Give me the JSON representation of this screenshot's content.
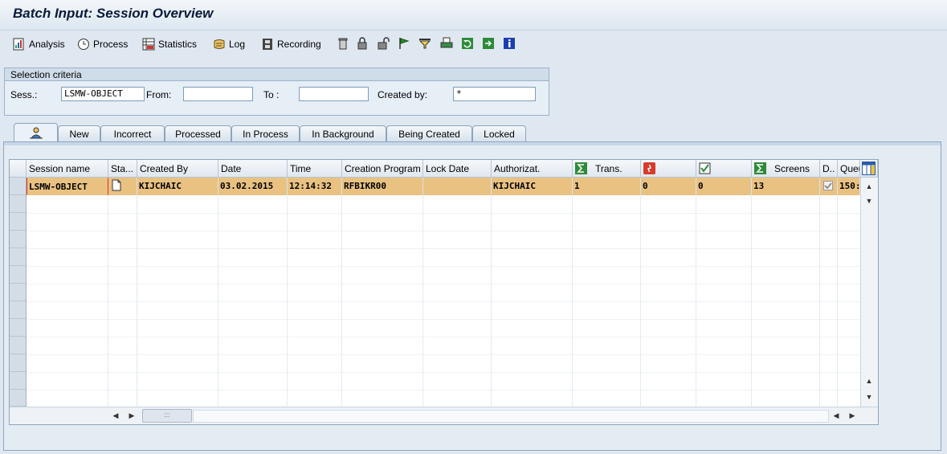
{
  "window": {
    "title": "Batch Input: Session Overview"
  },
  "toolbar": {
    "analysis": "Analysis",
    "process": "Process",
    "statistics": "Statistics",
    "log": "Log",
    "recording": "Recording"
  },
  "selection": {
    "title": "Selection criteria",
    "sess_label": "Sess.:",
    "sess_value": "LSMW-OBJECT",
    "from_label": "From:",
    "from_value": "",
    "to_label": "To :",
    "to_value": "",
    "created_by_label": "Created by:",
    "created_by_value": "*"
  },
  "tabs": [
    "New",
    "Incorrect",
    "Processed",
    "In Process",
    "In Background",
    "Being Created",
    "Locked"
  ],
  "table": {
    "columns": {
      "session_name": "Session name",
      "status": "Sta...",
      "created_by": "Created By",
      "date": "Date",
      "time": "Time",
      "creation_program": "Creation Program",
      "lock_date": "Lock Date",
      "authorization": "Authorizat.",
      "trans": "Trans.",
      "screens": "Screens",
      "d": "D..",
      "queue": "Queu"
    },
    "rows": [
      {
        "session_name": "LSMW-OBJECT",
        "created_by": "KIJCHAIC",
        "date": "03.02.2015",
        "time": "12:14:32",
        "creation_program": "RFBIKR00",
        "lock_date": "",
        "authorization": "KIJCHAIC",
        "trans": "1",
        "errors": "0",
        "processed": "0",
        "screens": "13",
        "queue": "150:"
      }
    ]
  },
  "colors": {
    "highlight_row": "#e9c282",
    "background": "#dfe8f1"
  }
}
